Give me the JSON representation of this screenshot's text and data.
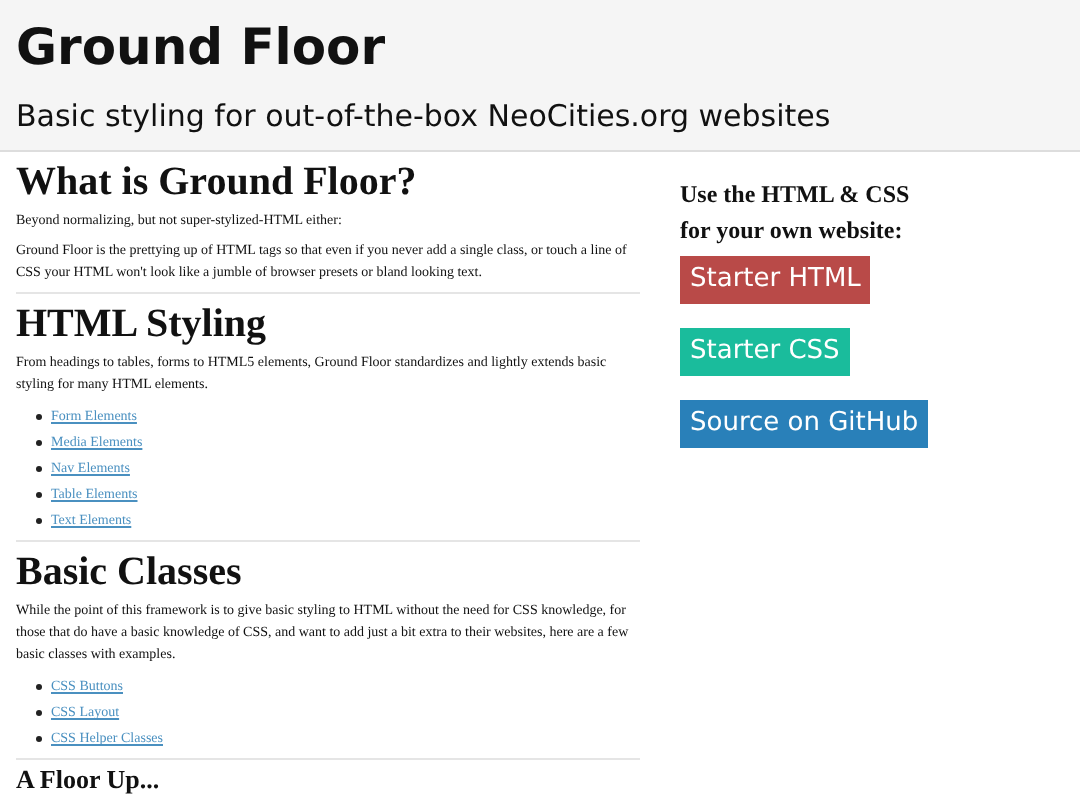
{
  "header": {
    "title": "Ground Floor",
    "subtitle": "Basic styling for out-of-the-box NeoCities.org websites"
  },
  "sections": [
    {
      "kind": "h1",
      "heading": "What is Ground Floor?",
      "paragraphs": [
        "Beyond normalizing, but not super-stylized-HTML either:",
        "Ground Floor is the prettying up of HTML tags so that even if you never add a single class, or touch a line of CSS your HTML won't look like a jumble of browser presets or bland looking text."
      ]
    },
    {
      "kind": "h1",
      "heading": "HTML Styling",
      "paragraphs": [
        "From headings to tables, forms to HTML5 elements, Ground Floor standardizes and lightly extends basic styling for many HTML elements."
      ],
      "links": [
        "Form Elements",
        "Media Elements",
        "Nav Elements",
        "Table Elements",
        "Text Elements"
      ]
    },
    {
      "kind": "h1",
      "heading": "Basic Classes",
      "paragraphs": [
        "While the point of this framework is to give basic styling to HTML without the need for CSS knowledge, for those that do have a basic knowledge of CSS, and want to add just a bit extra to their websites, here are a few basic classes with examples."
      ],
      "links": [
        "CSS Buttons",
        "CSS Layout",
        "CSS Helper Classes"
      ]
    },
    {
      "kind": "h2",
      "heading": "A Floor Up..."
    }
  ],
  "sidebar": {
    "heading_lines": [
      "Use the HTML & CSS",
      "for your own website:"
    ],
    "buttons": [
      {
        "label": "Starter HTML",
        "color": "#b94a48"
      },
      {
        "label": "Starter CSS",
        "color": "#1abc9c"
      },
      {
        "label": "Source on GitHub",
        "color": "#2980b9"
      }
    ]
  }
}
